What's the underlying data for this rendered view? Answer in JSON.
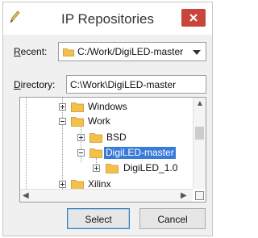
{
  "window": {
    "title": "IP Repositories",
    "close_label": "×"
  },
  "recent": {
    "label_accel": "R",
    "label_rest": "ecent:",
    "value": "C:/Work/DigiLED-master"
  },
  "directory": {
    "label_accel": "D",
    "label_rest": "irectory:",
    "value": "C:\\Work\\DigiLED-master"
  },
  "tree": {
    "items": [
      {
        "label": "Windows",
        "expander": "+",
        "selected": false
      },
      {
        "label": "Work",
        "expander": "-",
        "selected": false
      },
      {
        "label": "BSD",
        "expander": "+",
        "selected": false
      },
      {
        "label": "DigiLED-master",
        "expander": "-",
        "selected": true
      },
      {
        "label": "DigiLED_1.0",
        "expander": "+",
        "selected": false
      },
      {
        "label": "Xilinx",
        "expander": "+",
        "selected": false
      }
    ]
  },
  "buttons": {
    "select": "Select",
    "cancel": "Cancel"
  },
  "colors": {
    "close": "#c9443a",
    "selection": "#3a7ad9",
    "folder": "#f3c14b"
  },
  "icons": {
    "app": "pen-icon",
    "folder": "folder-icon",
    "close": "close-icon",
    "dropdown": "chevron-down-icon"
  }
}
